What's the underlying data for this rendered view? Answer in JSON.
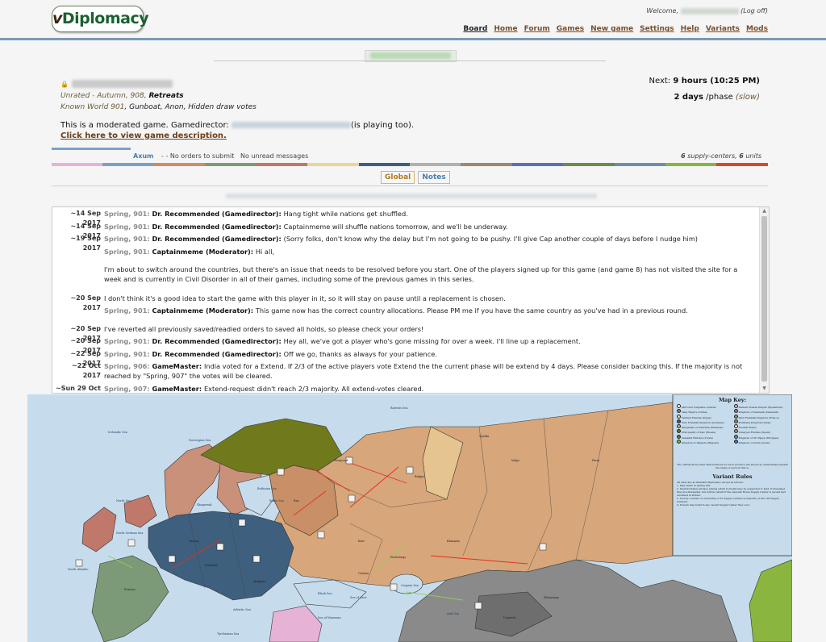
{
  "header": {
    "logo_prefix": "v",
    "logo_rest": "Diplomacy",
    "welcome": "Welcome,",
    "logoff": "(Log off)",
    "nav": [
      {
        "label": "Board",
        "active": true
      },
      {
        "label": "Home",
        "active": false
      },
      {
        "label": "Forum",
        "active": false
      },
      {
        "label": "Games",
        "active": false
      },
      {
        "label": "New game",
        "active": false
      },
      {
        "label": "Settings",
        "active": false
      },
      {
        "label": "Help",
        "active": false
      },
      {
        "label": "Variants",
        "active": false
      },
      {
        "label": "Mods",
        "active": false
      }
    ]
  },
  "game": {
    "rating": "Unrated",
    "season_text": " - Autumn, 908, ",
    "phase": "Retreats",
    "variant": "Known World 901",
    "options": ", Gunboat, Anon, Hidden draw votes",
    "next_label": "Next: ",
    "next_value": "9 hours (10:25 PM)",
    "phase_length": "2 days",
    "phase_suffix": " /phase ",
    "speed": "(slow)",
    "moderated": "This is a moderated game. Gamedirector: ",
    "playing_too": "(is playing too).",
    "desc_link": "Click here to view game description."
  },
  "member": {
    "country": "Axum",
    "dash": "-",
    "orders": "- No orders to submit",
    "unread": "No unread messages",
    "supply_centers": "6",
    "sc_label": " supply-centers, ",
    "units": "6",
    "units_label": " units"
  },
  "tabs": {
    "global": "Global",
    "notes": "Notes"
  },
  "colors": {
    "strip": [
      "#e6b3d6",
      "#7aa0c6",
      "#c98f66",
      "#7d9a78",
      "#c0786a",
      "#e8d79a",
      "#3e5f7e",
      "#b0b0b0",
      "#9a8a70",
      "#5d6fb3",
      "#6e8b4a",
      "#6f8fa8",
      "#8ab63f",
      "#d04a3a"
    ]
  },
  "chat": [
    {
      "date": "~14 Sep 2017",
      "phase": "Spring, 901",
      "who": "Dr. Recommended (Gamedirector)",
      "text": "Hang tight while nations get shuffled."
    },
    {
      "date": "~14 Sep 2017",
      "phase": "Spring, 901",
      "who": "Dr. Recommended (Gamedirector)",
      "text": "Captainmeme will shuffle nations tomorrow, and we'll be underway."
    },
    {
      "date": "~19 Sep 2017",
      "phase": "Spring, 901",
      "who": "Dr. Recommended (Gamedirector)",
      "text": "(Sorry folks, don't know why the delay but I'm not going to be pushy. I'll give Cap another couple of days before I nudge him)"
    },
    {
      "date": "",
      "phase": "Spring, 901",
      "who": "Captainmeme (Moderator)",
      "text": "Hi all,"
    },
    {
      "date": "",
      "phase": "",
      "who": "",
      "text": "I'm about to switch around the countries, but there's an issue that needs to be resolved before you start. One of the players signed up for this game (and game 8) has not visited the site for a week and is currently in Civil Disorder in all of their games, including some of the previous games in this series."
    },
    {
      "date": "~20 Sep 2017",
      "phase": "",
      "who": "",
      "text": "I don't think it's a good idea to start the game with this player in it, so it will stay on pause until a replacement is chosen."
    },
    {
      "date": "",
      "phase": "Spring, 901",
      "who": "Captainmeme (Moderator)",
      "text": "This game now has the correct country allocations. Please PM me if you have the same country as you've had in a previous round."
    },
    {
      "date": "~20 Sep 2017",
      "phase": "",
      "who": "",
      "text": "I've reverted all previously saved/readied orders to saved all holds, so please check your orders!"
    },
    {
      "date": "~20 Sep 2017",
      "phase": "Spring, 901",
      "who": "Dr. Recommended (Gamedirector)",
      "text": "Hey all, we've got a player who's gone missing for over a week. I'll line up a replacement."
    },
    {
      "date": "~22 Sep 2017",
      "phase": "Spring, 901",
      "who": "Dr. Recommended (Gamedirector)",
      "text": "Off we go, thanks as always for your patience."
    },
    {
      "date": "~22 Oct 2017",
      "phase": "Spring, 906",
      "who": "GameMaster",
      "text": "India voted for a Extend. If 2/3 of the active players vote Extend the the current phase will be extend by 4 days. Please consider backing this. If the majority is not reached by \"Spring, 907\" the votes will be cleared."
    },
    {
      "date": "~Sun 29 Oct",
      "phase": "Spring, 907",
      "who": "GameMaster",
      "text": "Extend-request didn't reach 2/3 majority. All extend-votes cleared."
    }
  ],
  "map": {
    "key_title": "Map Key:",
    "rules_title": "Variant Rules",
    "key_entries": [
      "Mirrored Caliphate (Arabia)",
      "Eastern Roman Empire (Byzantium)",
      "Tang Empire (China)",
      "Kingdom of Denmark (Denmark)",
      "Fatimid Emirate (Egypt)",
      "West Frankish Kingdom (France)",
      "East Frankish Kingdom (Germany)",
      "Pratihara Kingdom (India)",
      "Khaganate of Khazaria (Khazaria)",
      "Neutral States",
      "Principality of Kiev (Russia)",
      "Umayyad Emirate (Spain)",
      "Samanid Emirate (Turan)",
      "Kingdom of Sri Vijaya (Srivijaya)",
      "Kingdom of Wagadu (Wagadu)",
      "Kingdom of Axum (Axum)"
    ],
    "key_note": "The official three letter abbreviations for each province are shown as underlining beneath the name of each province.",
    "rules_intro": "All rules are as Standard Diplomacy except as follows:",
    "rules": [
      "1. Play starts in Spring 901.",
      "2. Neutral States all have armies which hold and may be supported to hold. If dislodged they are disbanded, but will be rebuilt if the relevant Home Supply Center is vacant and unowned in Winter.",
      "3. Victory consists of ownership of 55 Supply Centers (a majority of the 109 Supply Centers).",
      "4. Powers may build in any vacant Supply Center they own."
    ],
    "sea_labels": [
      "Icelandic Sea",
      "Norwegian Sea",
      "Barents Sea",
      "Bothnian Sea",
      "North Sea",
      "North German Sea",
      "Skagerrak",
      "Baltic Sea",
      "North Atlantic",
      "Tyrrhenian Sea",
      "Sea of Marmara",
      "Black Sea",
      "Caspian Sea",
      "Aral Sea",
      "Sea of Azov",
      "Adriatic Sea"
    ],
    "land_labels": [
      "Volga",
      "Bulgar",
      "Vyatka",
      "Perm",
      "Novgorod",
      "Kiev",
      "Khazaria",
      "Crimea",
      "Bohemia",
      "Saxony",
      "Francia",
      "Rus",
      "Pechenegs",
      "Magyars",
      "Khwarazm",
      "Urgench"
    ]
  }
}
